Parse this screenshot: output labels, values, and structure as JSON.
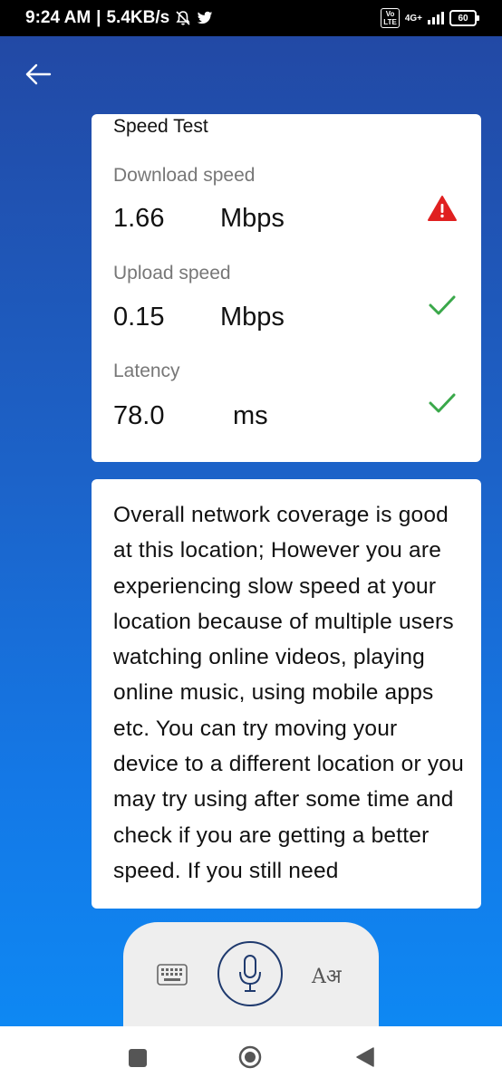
{
  "status_bar": {
    "time": "9:24 AM",
    "separator": "|",
    "speed": "5.4KB/s",
    "volte": "Vo\nLTE",
    "network": "4G+",
    "battery": "60"
  },
  "speed_card": {
    "title": "Speed Test",
    "download": {
      "label": "Download speed",
      "value": "1.66",
      "unit": "Mbps",
      "status": "warning"
    },
    "upload": {
      "label": "Upload speed",
      "value": "0.15",
      "unit": "Mbps",
      "status": "ok"
    },
    "latency": {
      "label": "Latency",
      "value": "78.0",
      "unit": "ms",
      "status": "ok"
    }
  },
  "message_card": {
    "text": "Overall network coverage is good at this location; However you are experiencing slow speed at your location because of multiple users watching online videos, playing online music, using mobile apps etc. You can try moving your device to a different location or you may try using after some time and check if you are getting a better speed. If you still need"
  },
  "voice_panel": {
    "translate_glyph": "Aअ"
  },
  "colors": {
    "warning": "#e02020",
    "ok": "#3aa84a",
    "mic": "#1f3a6e"
  }
}
